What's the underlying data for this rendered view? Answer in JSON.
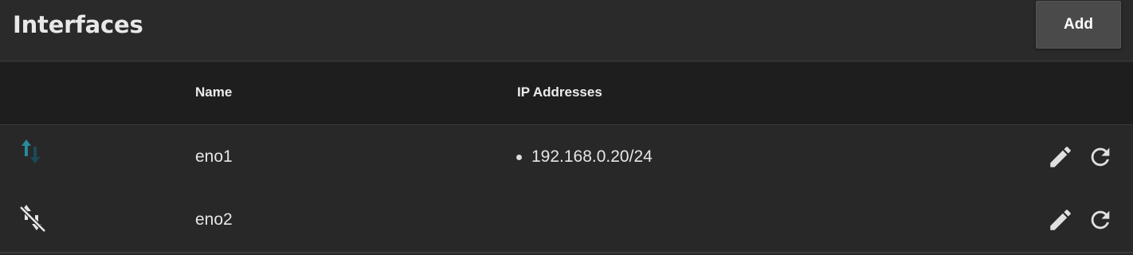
{
  "header": {
    "title": "Interfaces",
    "add_label": "Add"
  },
  "table": {
    "columns": [
      "",
      "Name",
      "IP Addresses",
      ""
    ],
    "rows": [
      {
        "status_icon": "link-up-arrows-icon",
        "name": "eno1",
        "ip_addresses": [
          "192.168.0.20/24"
        ],
        "actions": [
          "edit-icon",
          "reset-icon"
        ]
      },
      {
        "status_icon": "link-disconnected-icon",
        "name": "eno2",
        "ip_addresses": [],
        "actions": [
          "edit-icon",
          "reset-icon"
        ]
      }
    ]
  },
  "colors": {
    "background": "#282828",
    "table_header_bg": "#1e1e1e",
    "button_bg": "#4a4a4a",
    "link_up_teal": "#2a8a9a",
    "link_up_dark": "#1a4a5a",
    "icon_gray": "#e0e0e0"
  }
}
